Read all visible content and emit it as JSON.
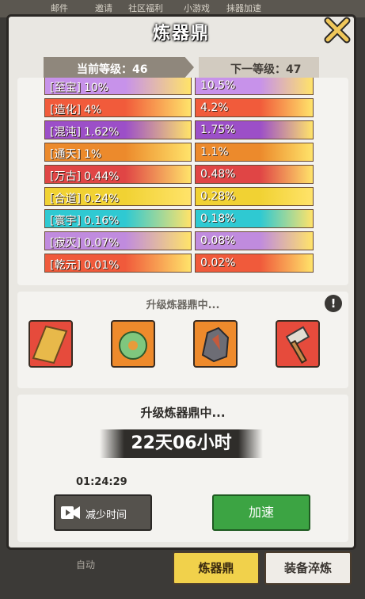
{
  "top_menu": [
    "邮件",
    "邀请",
    "社区福利",
    "小游戏",
    "抹器加速"
  ],
  "header": {
    "title": "炼器鼎"
  },
  "level": {
    "current_label": "当前等级：46",
    "next_label": "下一等级：47"
  },
  "stats": [
    {
      "name": "[至宝]",
      "cur": "10%",
      "next": "10.5%",
      "color": "#c792ea"
    },
    {
      "name": "[造化]",
      "cur": "4%",
      "next": "4.2%",
      "color": "#f15b3b"
    },
    {
      "name": "[混沌]",
      "cur": "1.62%",
      "next": "1.75%",
      "color": "#9c4fc8"
    },
    {
      "name": "[通天]",
      "cur": "1%",
      "next": "1.1%",
      "color": "#ec8a2c"
    },
    {
      "name": "[万古]",
      "cur": "0.44%",
      "next": "0.48%",
      "color": "#e04545"
    },
    {
      "name": "[合道]",
      "cur": "0.24%",
      "next": "0.28%",
      "color": "#f1d233"
    },
    {
      "name": "[寰宇]",
      "cur": "0.16%",
      "next": "0.18%",
      "color": "#2fc9d2"
    },
    {
      "name": "[寂灭]",
      "cur": "0.07%",
      "next": "0.08%",
      "color": "#c08bde"
    },
    {
      "name": "[乾元]",
      "cur": "0.01%",
      "next": "0.02%",
      "color": "#f05a3b"
    }
  ],
  "materials": {
    "title": "升级炼器鼎中...",
    "info_icon": "exclamation-icon",
    "items": [
      "scroll",
      "jade-pendant",
      "ore",
      "hammer"
    ]
  },
  "upgrade": {
    "title": "升级炼器鼎中...",
    "remaining": "22天06小时",
    "clock": "01:24:29",
    "reduce_label": "减少时间",
    "speed_label": "加速"
  },
  "tabs": {
    "furnace": "炼器鼎",
    "refine": "装备淬炼",
    "auto": "自动"
  }
}
